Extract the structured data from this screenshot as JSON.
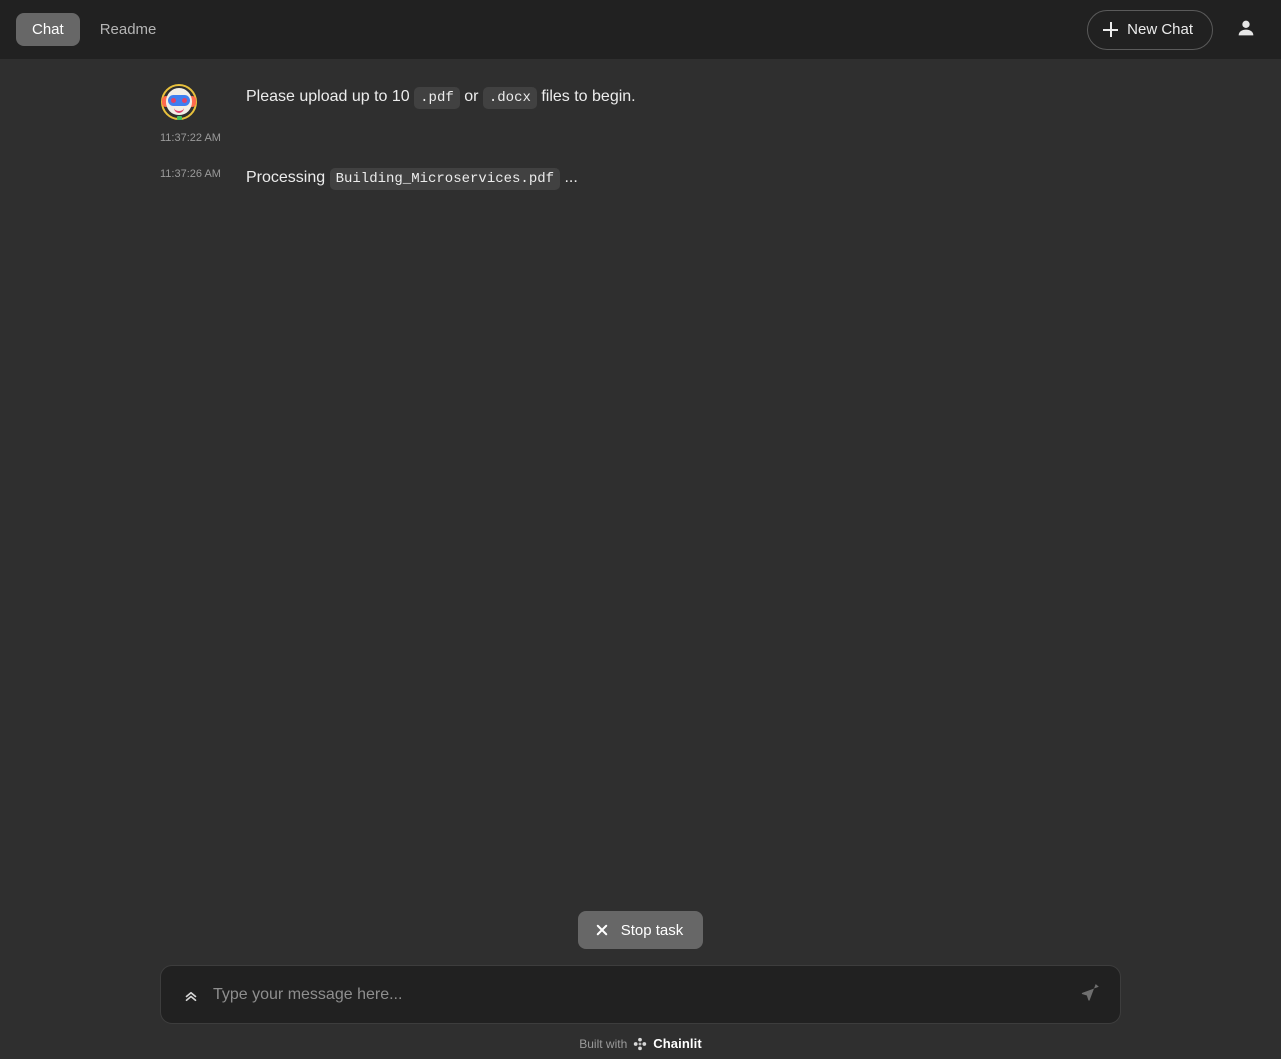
{
  "header": {
    "tabs": [
      {
        "label": "Chat",
        "active": true,
        "name": "tab-chat"
      },
      {
        "label": "Readme",
        "active": false,
        "name": "tab-readme"
      }
    ],
    "new_chat_label": "New Chat",
    "plus_icon": "plus-icon",
    "user_icon": "user-icon"
  },
  "conversation": {
    "messages": [
      {
        "timestamp": "11:37:22 AM",
        "has_avatar": true,
        "avatar_icon": "robot-avatar-icon",
        "parts": [
          {
            "type": "text",
            "value": "Please upload up to 10 "
          },
          {
            "type": "code",
            "value": ".pdf"
          },
          {
            "type": "text",
            "value": " or "
          },
          {
            "type": "code",
            "value": ".docx"
          },
          {
            "type": "text",
            "value": " files to begin."
          }
        ],
        "text_1": "Please upload up to 10 ",
        "code_1": ".pdf",
        "text_2": " or ",
        "code_2": ".docx",
        "text_3": " files to begin."
      },
      {
        "timestamp": "11:37:26 AM",
        "has_avatar": false,
        "text_1": "Processing ",
        "code_1": "Building_Microservices.pdf",
        "text_2": " ..."
      }
    ]
  },
  "composer": {
    "stop_task_label": "Stop task",
    "stop_task_icon": "close-icon",
    "attach_icon": "chevrons-up-icon",
    "send_icon": "send-icon",
    "input_value": "",
    "placeholder": "Type your message here..."
  },
  "footer": {
    "built_with": "Built with",
    "brand": "Chainlit",
    "logo_icon": "chainlit-logo-icon"
  },
  "colors": {
    "page_background": "#2f2f2f",
    "header_background": "#212121",
    "active_tab_background": "#676767",
    "code_chip_background": "#414141",
    "composer_background": "#212121",
    "primary_text": "#ececec",
    "muted_text": "#9a9a9a"
  }
}
